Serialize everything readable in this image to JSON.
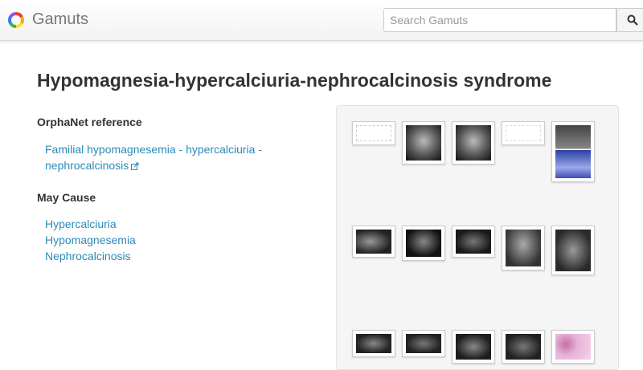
{
  "header": {
    "brand": "Gamuts",
    "search_placeholder": "Search Gamuts"
  },
  "page": {
    "title": "Hypomagnesia-hypercalciuria-nephrocalcinosis syndrome"
  },
  "orphanet": {
    "heading": "OrphaNet reference",
    "link_line1": "Familial hypomagnesemia - hypercalciuria -",
    "link_line2": "nephrocalcinosis"
  },
  "may_cause": {
    "heading": "May Cause",
    "items": [
      "Hypercalciuria",
      "Hypomagnesemia",
      "Nephrocalcinosis"
    ]
  },
  "gallery": {
    "thumbnails": [
      {
        "kind": "chart-white"
      },
      {
        "kind": "xray-dark"
      },
      {
        "kind": "xray-dark"
      },
      {
        "kind": "chart-white"
      },
      {
        "kind": "mri-histology"
      },
      {
        "kind": "ultrasound"
      },
      {
        "kind": "ultrasound"
      },
      {
        "kind": "ultrasound"
      },
      {
        "kind": "ultrasound"
      },
      {
        "kind": "ultrasound"
      },
      {
        "kind": "ultrasound"
      },
      {
        "kind": "ultrasound"
      },
      {
        "kind": "ultrasound"
      },
      {
        "kind": "ultrasound"
      },
      {
        "kind": "histology-pink"
      }
    ]
  }
}
